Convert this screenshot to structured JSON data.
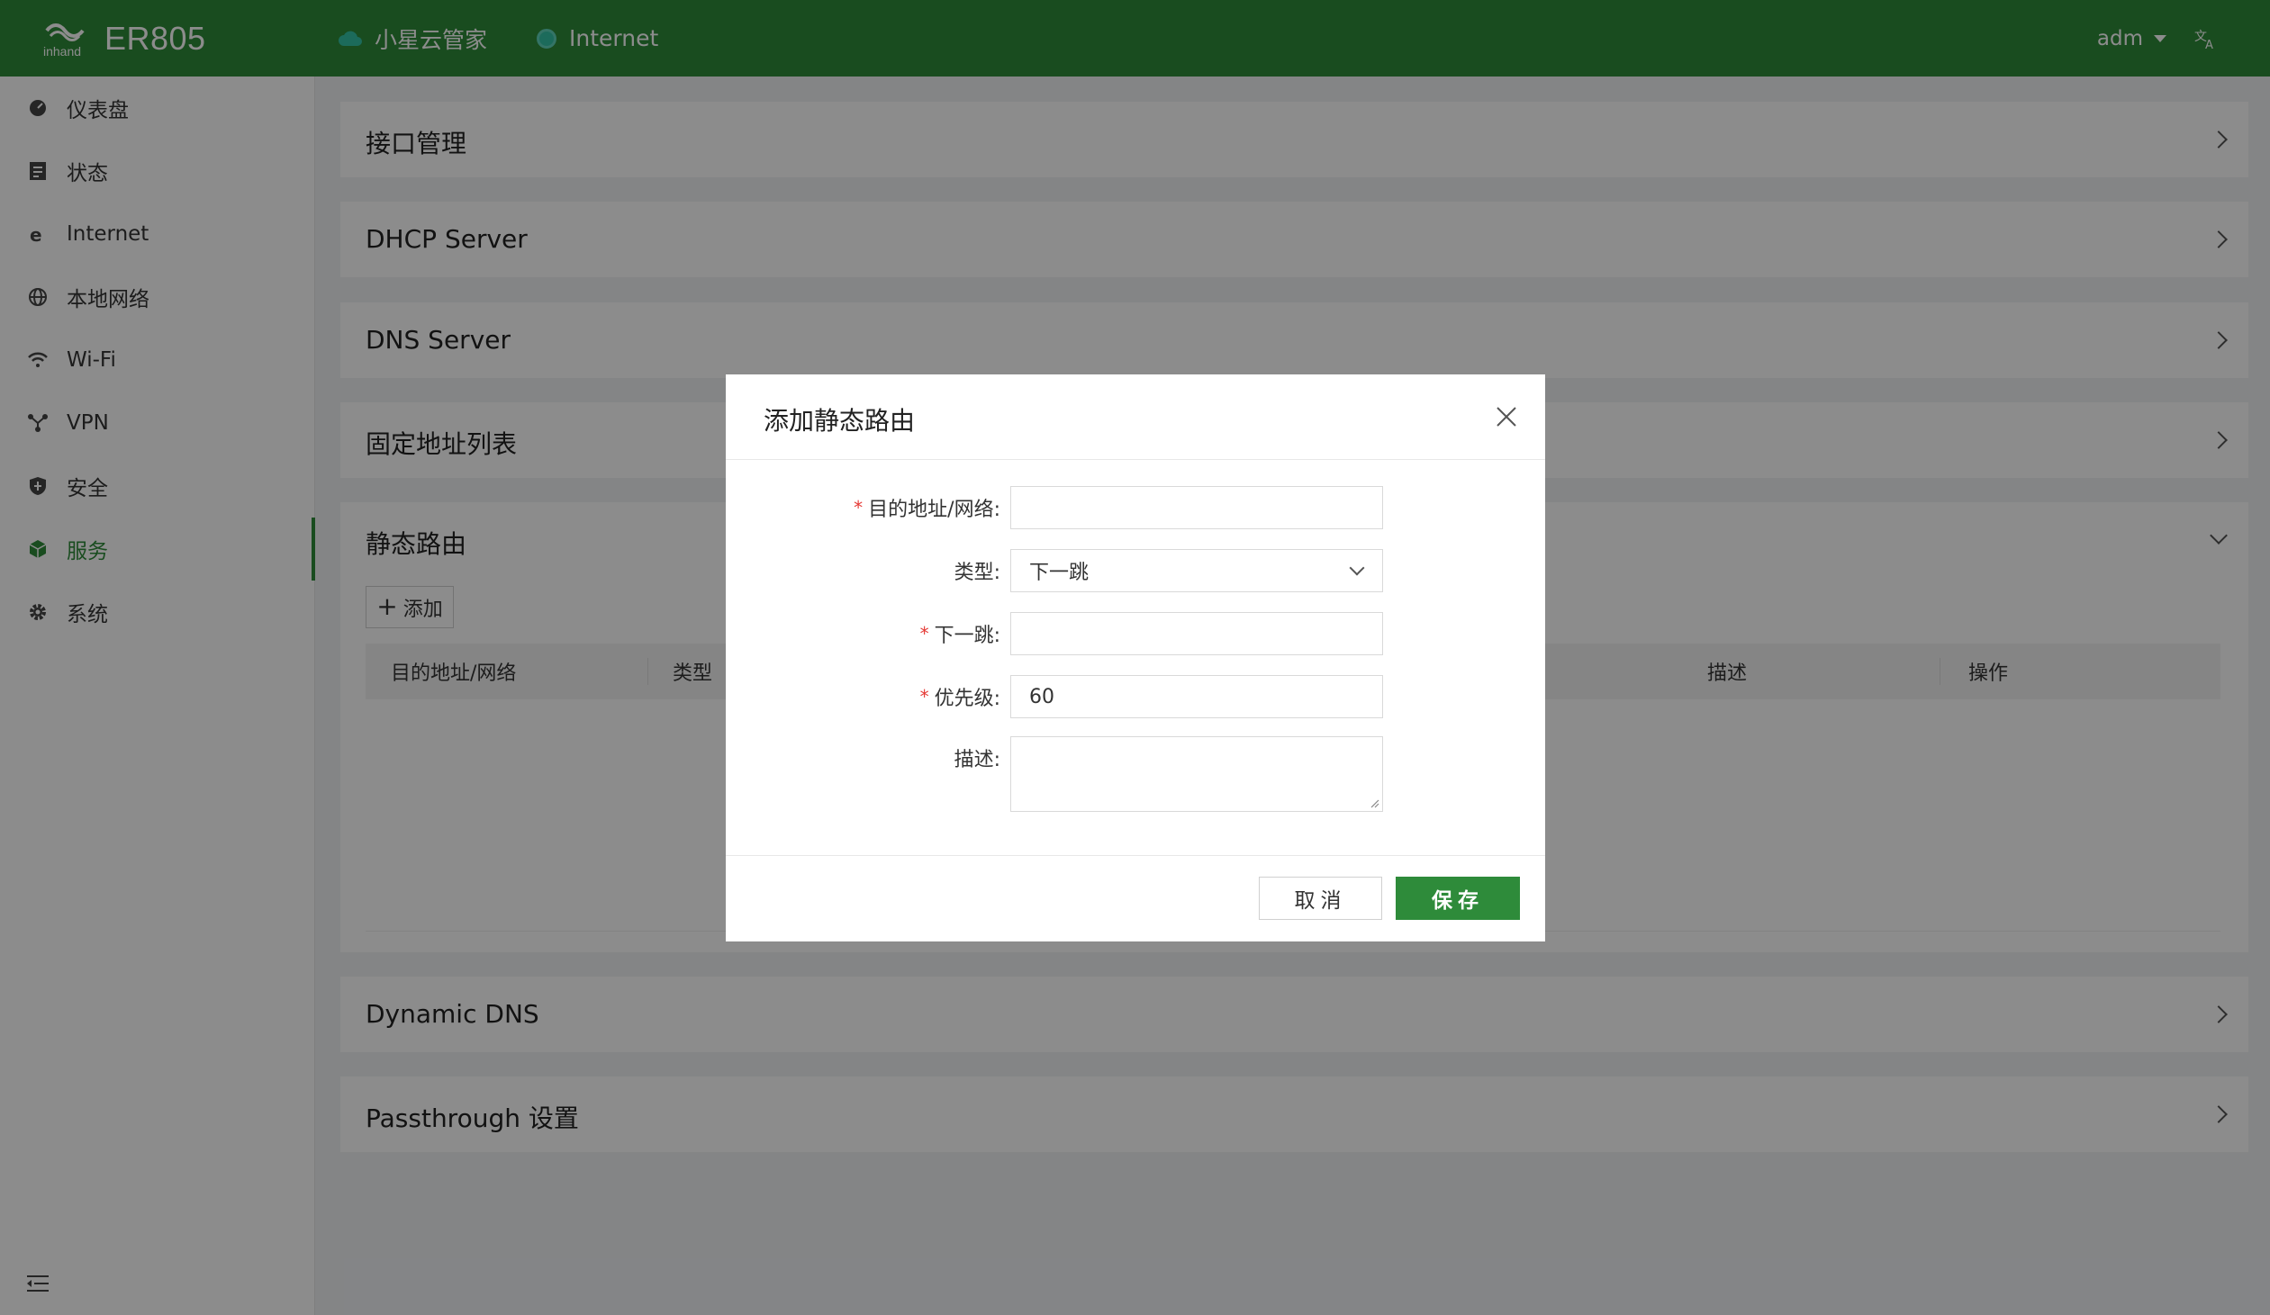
{
  "header": {
    "brand_logo_text": "inhand",
    "product": "ER805",
    "cloud_label": "小星云管家",
    "internet_label": "Internet",
    "user": "adm",
    "lang_icon": "translate-icon"
  },
  "sidebar": {
    "items": [
      {
        "label": "仪表盘",
        "icon": "dashboard-icon"
      },
      {
        "label": "状态",
        "icon": "status-icon"
      },
      {
        "label": "Internet",
        "icon": "internet-icon"
      },
      {
        "label": "本地网络",
        "icon": "globe-icon"
      },
      {
        "label": "Wi-Fi",
        "icon": "wifi-icon"
      },
      {
        "label": "VPN",
        "icon": "vpn-icon"
      },
      {
        "label": "安全",
        "icon": "shield-icon"
      },
      {
        "label": "服务",
        "icon": "cube-icon",
        "active": true
      },
      {
        "label": "系统",
        "icon": "gear-icon"
      }
    ]
  },
  "panels": {
    "interface": "接口管理",
    "dhcp": "DHCP Server",
    "dns": "DNS Server",
    "fixed": "固定地址列表",
    "static_route": "静态路由",
    "ddns": "Dynamic DNS",
    "passthrough": "Passthrough 设置"
  },
  "static_route": {
    "add_label": "添加",
    "columns": [
      "目的地址/网络",
      "类型",
      "描述",
      "操作"
    ]
  },
  "modal": {
    "title": "添加静态路由",
    "fields": {
      "dest_label": "目的地址/网络:",
      "dest_value": "",
      "type_label": "类型:",
      "type_value": "下一跳",
      "nexthop_label": "下一跳:",
      "nexthop_value": "",
      "priority_label": "优先级:",
      "priority_value": "60",
      "desc_label": "描述:"
    },
    "cancel_label": "取消",
    "save_label": "保存"
  },
  "colors": {
    "brand": "#2e8b3a",
    "required": "#e53935"
  }
}
